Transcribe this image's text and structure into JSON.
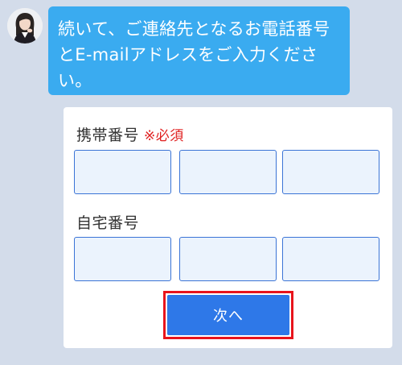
{
  "chat": {
    "avatar_icon": "operator-avatar-icon",
    "message": "続いて、ご連絡先となるお電話番号とE-mailアドレスをご入力ください。"
  },
  "form": {
    "mobile": {
      "label": "携帯番号",
      "required": "※必須"
    },
    "home": {
      "label": "自宅番号"
    },
    "next_label": "次へ"
  },
  "colors": {
    "background": "#d3dcea",
    "bubble": "#3aabf0",
    "input_border": "#3b74d6",
    "input_fill": "#ebf3fd",
    "button": "#2e78e8",
    "required": "#e02020",
    "highlight": "#e8141c"
  }
}
